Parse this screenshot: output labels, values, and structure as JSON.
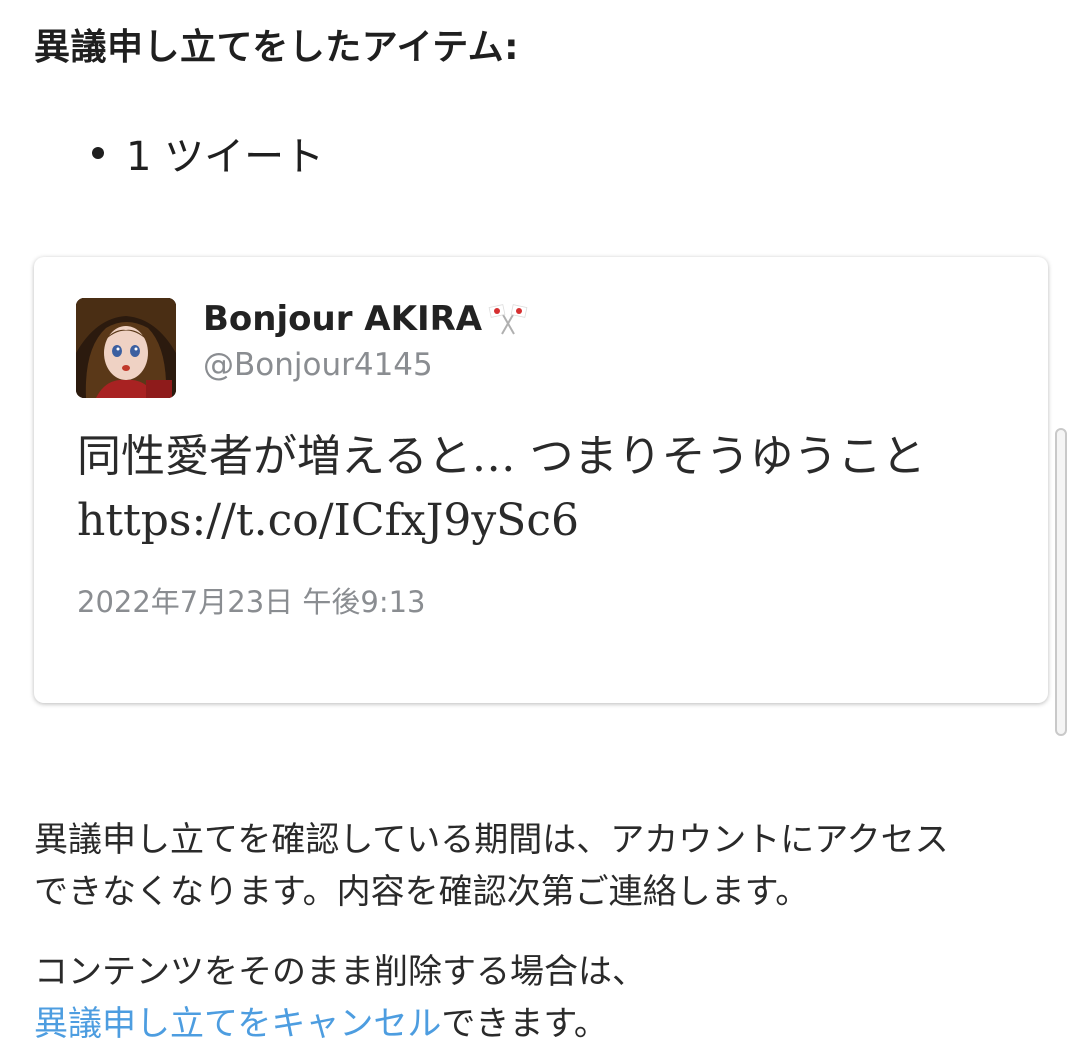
{
  "heading": "異議申し立てをしたアイテム:",
  "items": [
    "1 ツイート"
  ],
  "tweet": {
    "display_name": "Bonjour AKIRA",
    "handle": "@Bonjour4145",
    "text_line1": "同性愛者が増えると… つまりそうゆうこと",
    "text_line2": "https://t.co/ICfxJ9ySc6",
    "timestamp": "2022年7月23日 午後9:13",
    "name_emoji": "crossed-flags-icon"
  },
  "review_note": {
    "line1": "異議申し立てを確認している期間は、アカウントにアクセス",
    "line2": "できなくなります。内容を確認次第ご連絡します。"
  },
  "cancel_note": {
    "line1": "コンテンツをそのまま削除する場合は、",
    "link": "異議申し立てをキャンセル",
    "suffix": "できます。"
  },
  "colors": {
    "link": "#4d9de0",
    "muted": "#8a8d91",
    "text": "#222222"
  }
}
